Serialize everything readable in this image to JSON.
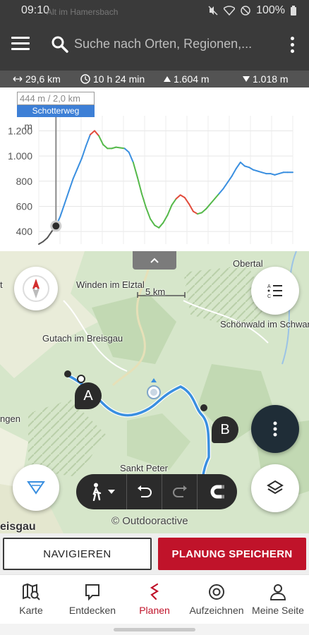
{
  "status_bar": {
    "time": "09:10",
    "ghost_text": "Alt im Hamersbach",
    "battery": "100%"
  },
  "toolbar": {
    "search_placeholder": "Suche nach Orten, Regionen,..."
  },
  "stats": {
    "distance": "29,6 km",
    "duration": "10 h 24 min",
    "ascent": "1.604 m",
    "descent": "1.018 m"
  },
  "elevation_chart": {
    "unit": "m",
    "y_ticks": [
      "1.200",
      "1.000",
      "800",
      "600",
      "400"
    ],
    "cursor_value": "444 m / 2,0 km",
    "cursor_surface": "Schotterweg"
  },
  "chart_data": {
    "type": "line",
    "title": "",
    "xlabel": "",
    "ylabel": "m",
    "xlim": [
      0,
      29.6
    ],
    "ylim": [
      300,
      1320
    ],
    "y_ticks": [
      400,
      600,
      800,
      1000,
      1200
    ],
    "series": [
      {
        "x": [
          0,
          0.5,
          1.0,
          1.5,
          2.0,
          2.5,
          3.0,
          3.5,
          4.0,
          4.5,
          5.0,
          5.5,
          6.0,
          6.5,
          7.0,
          7.5,
          8.0,
          8.5,
          9.0,
          9.5,
          10.0,
          10.5,
          11.0,
          11.5,
          12.0,
          12.5,
          13.0,
          13.5,
          14.0,
          14.5,
          15.0,
          15.5,
          16.0,
          16.5,
          17.0,
          17.5,
          18.0,
          18.5,
          19.0,
          19.5,
          20.0,
          20.5,
          21.0,
          21.5,
          22.0,
          22.5,
          23.0,
          23.5,
          24.0,
          24.5,
          25.0,
          25.5,
          26.0,
          26.5,
          27.0,
          27.5,
          28.0,
          28.5,
          29.0,
          29.6
        ],
        "values": [
          300,
          320,
          350,
          400,
          444,
          520,
          620,
          720,
          820,
          900,
          980,
          1080,
          1170,
          1200,
          1160,
          1090,
          1060,
          1060,
          1070,
          1065,
          1060,
          1030,
          950,
          830,
          700,
          590,
          500,
          450,
          430,
          470,
          530,
          610,
          660,
          690,
          670,
          620,
          560,
          540,
          550,
          580,
          620,
          660,
          700,
          740,
          790,
          840,
          900,
          950,
          920,
          910,
          890,
          880,
          870,
          860,
          860,
          850,
          860,
          870,
          870,
          870
        ]
      }
    ]
  },
  "map": {
    "labels": {
      "winden": "Winden im Elztal",
      "gutach": "Gutach im Breisgau",
      "obertal": "Obertal",
      "schonwald": "Schönwald im Schwarzw",
      "sankt_peter": "Sankt Peter",
      "left_edge_top": "t",
      "left_edge_mid": "ngen",
      "left_edge_bottom": "eisgau"
    },
    "scale": "5 km",
    "marker_a": "A",
    "marker_b": "B",
    "copyright": "© Outdooractive"
  },
  "actions": {
    "navigate": "NAVIGIEREN",
    "save": "PLANUNG SPEICHERN"
  },
  "bottom_nav": [
    {
      "label": "Karte",
      "icon": "map-search-icon"
    },
    {
      "label": "Entdecken",
      "icon": "chat-icon"
    },
    {
      "label": "Planen",
      "icon": "route-icon",
      "active": true
    },
    {
      "label": "Aufzeichnen",
      "icon": "record-icon"
    },
    {
      "label": "Meine Seite",
      "icon": "person-icon"
    }
  ],
  "colors": {
    "accent_red": "#c0132a",
    "track_blue": "#3a8fe0",
    "dark": "#2b2b2b"
  }
}
